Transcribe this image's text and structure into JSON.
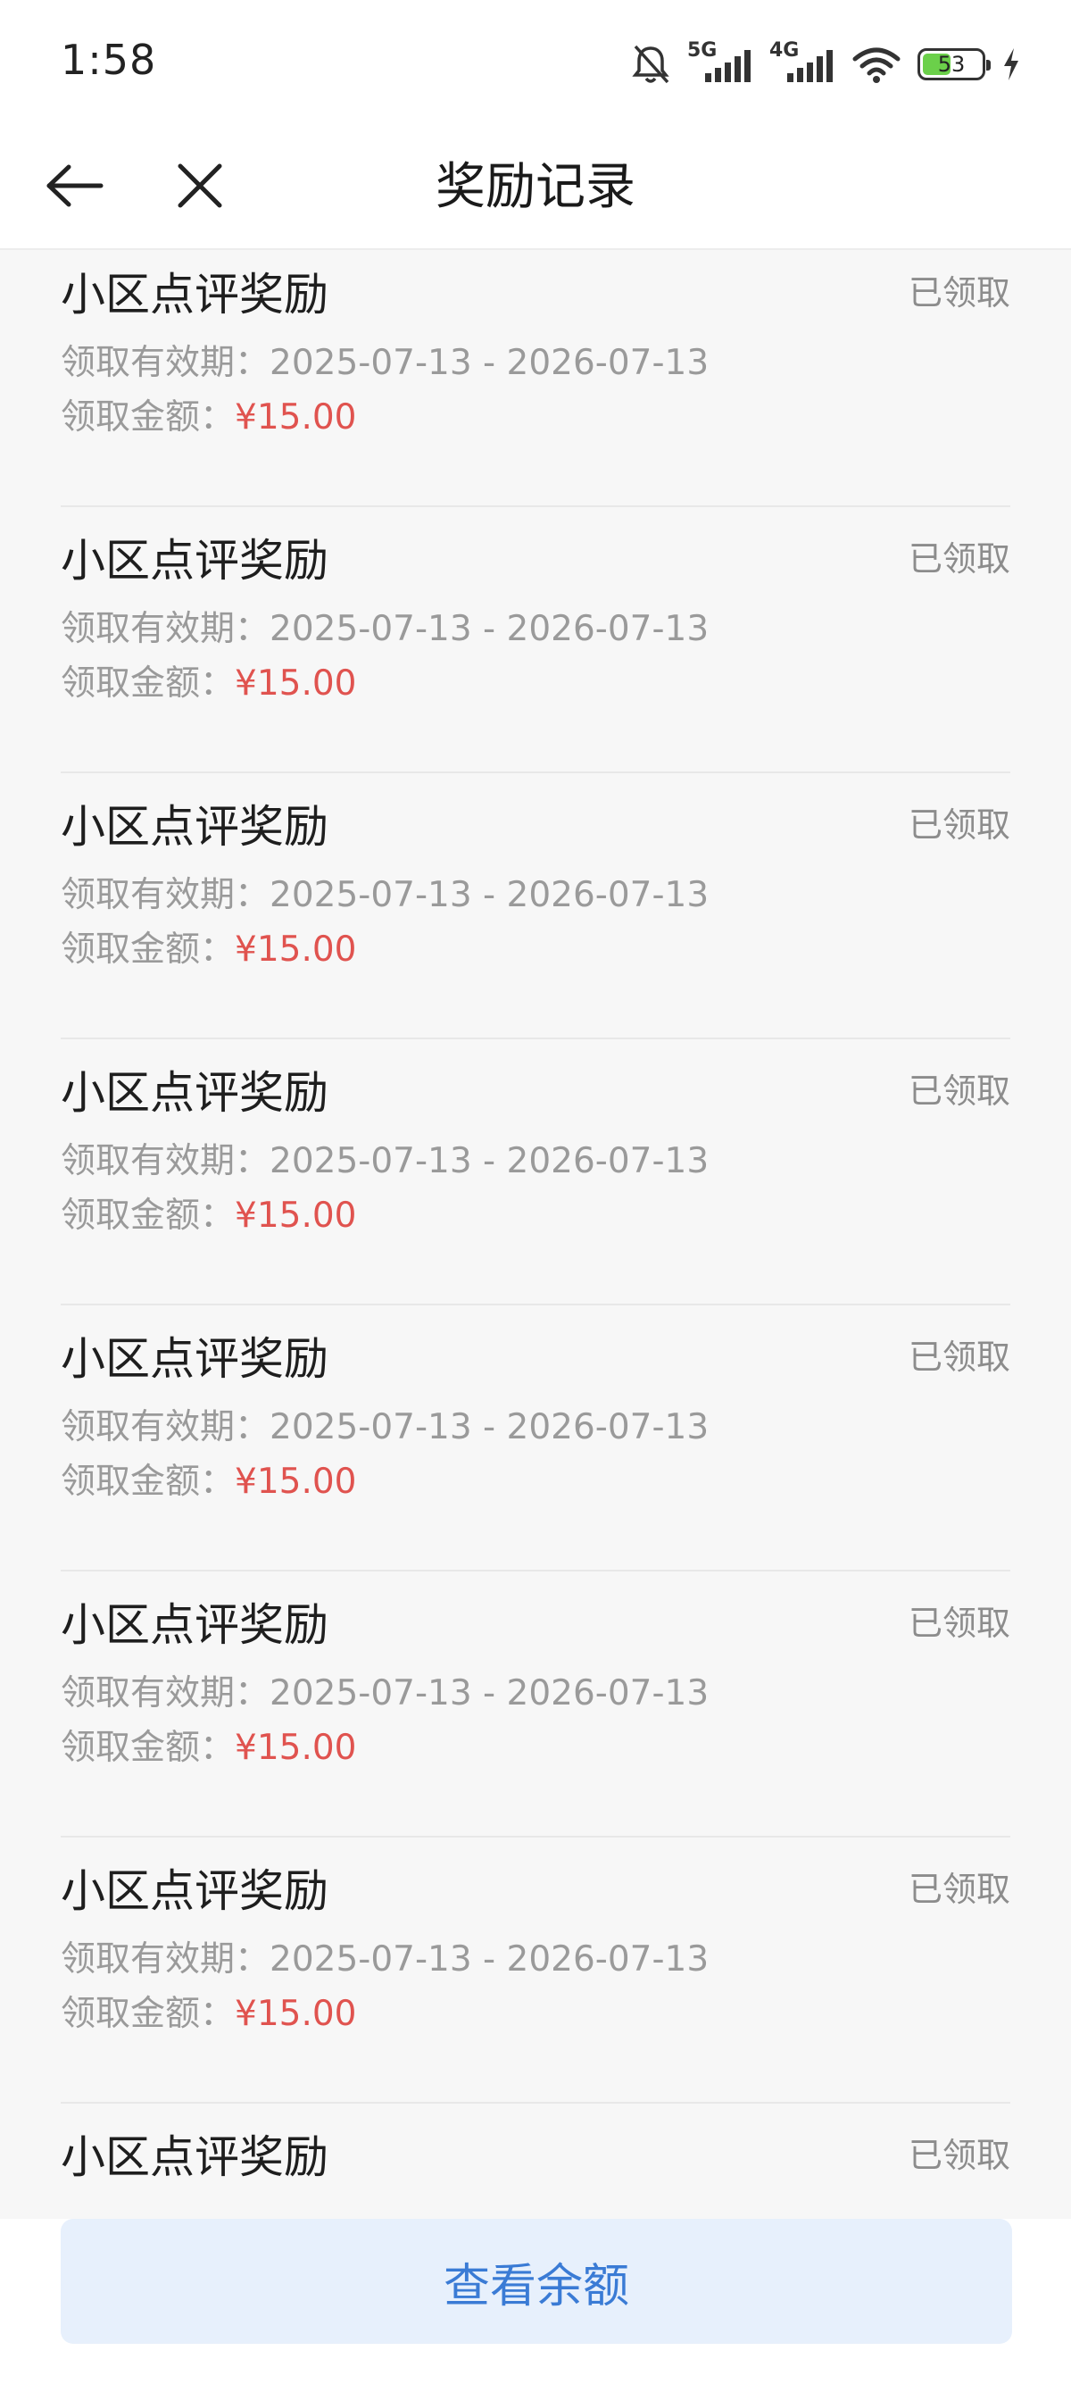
{
  "status_bar": {
    "time": "1:58",
    "network_1": "5G",
    "network_2": "4G",
    "battery_level": "53",
    "battery_fraction": 0.53,
    "icons": [
      "mute-bell-icon",
      "signal-5g-icon",
      "signal-4g-icon",
      "wifi-icon",
      "battery-icon",
      "charging-icon"
    ]
  },
  "nav": {
    "title": "奖励记录",
    "back_icon": "back-arrow-icon",
    "close_icon": "close-icon"
  },
  "rewards": [
    {
      "title": "小区点评奖励",
      "status": "已领取",
      "validity_label": "领取有效期：",
      "validity": "2025-07-13 - 2026-07-13",
      "amount_label": "领取金额：",
      "amount": "¥15.00"
    },
    {
      "title": "小区点评奖励",
      "status": "已领取",
      "validity_label": "领取有效期：",
      "validity": "2025-07-13 - 2026-07-13",
      "amount_label": "领取金额：",
      "amount": "¥15.00"
    },
    {
      "title": "小区点评奖励",
      "status": "已领取",
      "validity_label": "领取有效期：",
      "validity": "2025-07-13 - 2026-07-13",
      "amount_label": "领取金额：",
      "amount": "¥15.00"
    },
    {
      "title": "小区点评奖励",
      "status": "已领取",
      "validity_label": "领取有效期：",
      "validity": "2025-07-13 - 2026-07-13",
      "amount_label": "领取金额：",
      "amount": "¥15.00"
    },
    {
      "title": "小区点评奖励",
      "status": "已领取",
      "validity_label": "领取有效期：",
      "validity": "2025-07-13 - 2026-07-13",
      "amount_label": "领取金额：",
      "amount": "¥15.00"
    },
    {
      "title": "小区点评奖励",
      "status": "已领取",
      "validity_label": "领取有效期：",
      "validity": "2025-07-13 - 2026-07-13",
      "amount_label": "领取金额：",
      "amount": "¥15.00"
    },
    {
      "title": "小区点评奖励",
      "status": "已领取",
      "validity_label": "领取有效期：",
      "validity": "2025-07-13 - 2026-07-13",
      "amount_label": "领取金额：",
      "amount": "¥15.00"
    },
    {
      "title": "小区点评奖励",
      "status": "已领取"
    }
  ],
  "bottom": {
    "button_label": "查看余额"
  },
  "colors": {
    "amount": "#e0534f",
    "button_bg": "#e7f0fc",
    "button_text": "#3a7bd5",
    "muted_text": "#9a9a9a",
    "page_bg": "#f7f7f7"
  }
}
